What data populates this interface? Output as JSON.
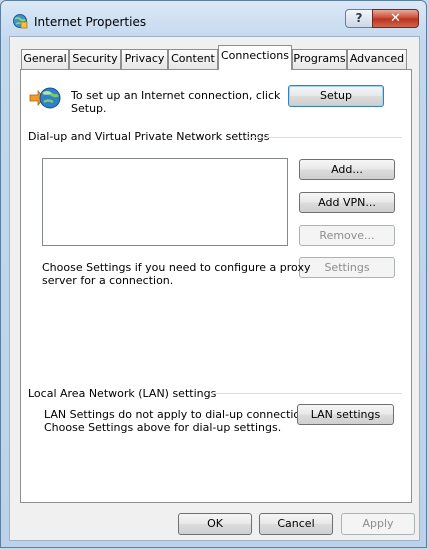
{
  "window": {
    "title": "Internet Properties",
    "help_label": "?",
    "close_label": "✕"
  },
  "tabs": [
    {
      "label": "General",
      "active": false
    },
    {
      "label": "Security",
      "active": false
    },
    {
      "label": "Privacy",
      "active": false
    },
    {
      "label": "Content",
      "active": false
    },
    {
      "label": "Connections",
      "active": true
    },
    {
      "label": "Programs",
      "active": false
    },
    {
      "label": "Advanced",
      "active": false
    }
  ],
  "setup_section": {
    "text_line1": "To set up an Internet connection, click",
    "text_line2": "Setup.",
    "setup_button": "Setup"
  },
  "dialup_section": {
    "heading": "Dial-up and Virtual Private Network settings",
    "add_button": "Add...",
    "add_vpn_button": "Add VPN...",
    "remove_button": "Remove...",
    "settings_button": "Settings",
    "proxy_text_line1": "Choose Settings if you need to configure a proxy",
    "proxy_text_line2": "server for a connection."
  },
  "lan_section": {
    "heading": "Local Area Network (LAN) settings",
    "text_line1": "LAN Settings do not apply to dial-up connections.",
    "text_line2": "Choose Settings above for dial-up settings.",
    "lan_button": "LAN settings"
  },
  "footer": {
    "ok": "OK",
    "cancel": "Cancel",
    "apply": "Apply"
  }
}
